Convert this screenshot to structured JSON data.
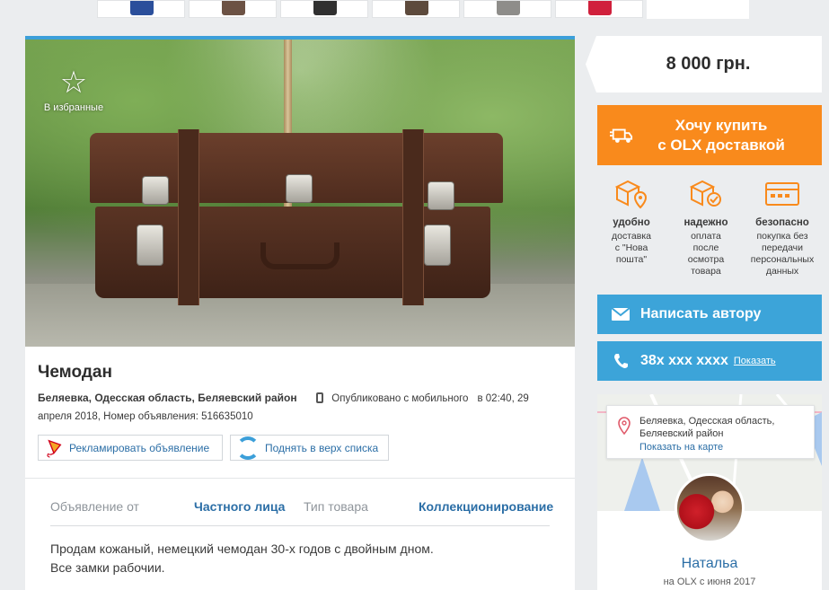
{
  "thumbnails": [
    {
      "color": "#2b4f9b"
    },
    {
      "color": "#6c5244"
    },
    {
      "color": "#303030"
    },
    {
      "color": "#5d4a3c"
    },
    {
      "color": "#8e8d8a"
    },
    {
      "color": "#d0203c"
    }
  ],
  "favorite": {
    "label": "В избранные",
    "icon": "star-icon"
  },
  "ad": {
    "title": "Чемодан",
    "location": "Беляевка, Одесская область, Беляевский район",
    "published_mobile": "Опубликовано с мобильного",
    "published_time": "в 02:40, 29",
    "published_date": "апреля 2018, Номер объявления: 516635010",
    "promote_label": "Рекламировать объявление",
    "raise_label": "Поднять в верх списка",
    "params": {
      "from_label": "Объявление от",
      "from_value": "Частного лица",
      "type_label": "Тип товара",
      "type_value": "Коллекционирование"
    },
    "description_line1": "Продам кожаный, немецкий чемодан 30-х годов с двойным дном.",
    "description_line2": "Все замки рабочии."
  },
  "price": "8 000 грн.",
  "buy": {
    "text": "Хочу купить\nс OLX доставкой",
    "color": "#f98a1c"
  },
  "features": [
    {
      "title": "удобно",
      "desc": "доставка\nс \"Нова\nпошта\"",
      "icon": "box-location-icon"
    },
    {
      "title": "надежно",
      "desc": "оплата\nпосле\nосмотра\nтовара",
      "icon": "box-check-icon"
    },
    {
      "title": "безопасно",
      "desc": "покупка без\nпередачи\nперсональных\nданных",
      "icon": "card-icon"
    }
  ],
  "contact": {
    "message_label": "Написать автору",
    "phone_label": "38х ххх хххх",
    "show_label": "Показать",
    "button_color": "#3ca4d9"
  },
  "seller": {
    "location": "Беляевка, Одесская область, Беляевский район",
    "map_link": "Показать на карте",
    "name": "Натальа",
    "since": "на OLX с июня 2017"
  }
}
